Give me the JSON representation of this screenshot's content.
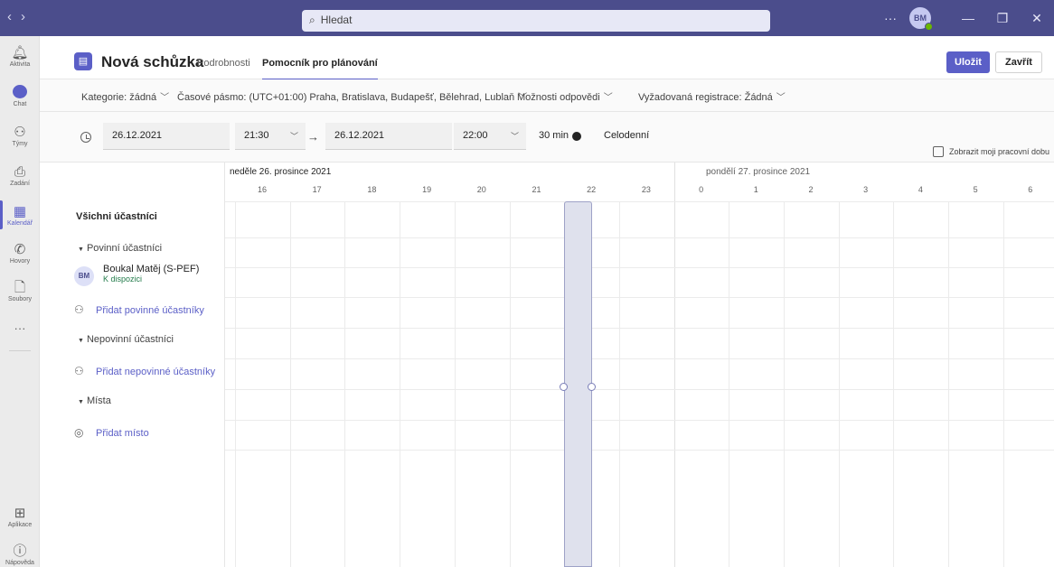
{
  "titlebar": {
    "search_placeholder": "Hledat",
    "more": "···",
    "user_initials": "BM",
    "minimize": "—",
    "maximize": "❐",
    "close": "✕"
  },
  "rail": [
    {
      "label": "Aktivita",
      "icon": "bell-icon"
    },
    {
      "label": "Chat",
      "icon": "chat-icon"
    },
    {
      "label": "Týmy",
      "icon": "teams-icon"
    },
    {
      "label": "Zadání",
      "icon": "assignments-icon"
    },
    {
      "label": "Kalendář",
      "icon": "calendar-icon"
    },
    {
      "label": "Hovory",
      "icon": "phone-icon"
    },
    {
      "label": "Soubory",
      "icon": "file-icon"
    },
    {
      "label": "···",
      "icon": "more-icon"
    },
    {
      "label": "Aplikace",
      "icon": "apps-icon"
    },
    {
      "label": "Nápověda",
      "icon": "help-icon"
    }
  ],
  "header": {
    "title": "Nová schůzka",
    "tab_details": "Podrobnosti",
    "tab_assistant": "Pomocník pro plánování",
    "save": "Uložit",
    "close": "Zavřít"
  },
  "options": {
    "category": "Kategorie: žádná",
    "timezone": "Časové pásmo: (UTC+01:00) Praha, Bratislava, Budapešť, Bělehrad, Lublaň",
    "response": "Možnosti odpovědi",
    "registration": "Vyžadovaná registrace: Žádná"
  },
  "time": {
    "start_date": "26.12.2021",
    "start_time": "21:30",
    "end_date": "26.12.2021",
    "end_time": "22:00",
    "duration": "30 min",
    "all_day": "Celodenní",
    "show_work_hours": "Zobrazit moji pracovní dobu"
  },
  "attendees": {
    "all": "Všichni účastníci",
    "required_section": "Povinní účastníci",
    "person_initials": "BM",
    "person_name": "Boukal Matěj (S-PEF)",
    "person_status": "K dispozici",
    "add_required": "Přidat povinné účastníky",
    "optional_section": "Nepovinní účastníci",
    "add_optional": "Přidat nepovinné účastníky",
    "places_section": "Místa",
    "add_place": "Přidat místo"
  },
  "schedule": {
    "day1": "neděle 26. prosince 2021",
    "day2": "pondělí 27. prosince 2021",
    "hours_day1": [
      "16",
      "17",
      "18",
      "19",
      "20",
      "21",
      "22",
      "23"
    ],
    "hours_day2": [
      "0",
      "1",
      "2",
      "3",
      "4",
      "5",
      "6"
    ],
    "selected_from": "21:30",
    "selected_to": "22:00"
  },
  "colors": {
    "accent": "#5b5fc7",
    "titlebar": "#4b4d8c",
    "available": "#237b4b"
  }
}
